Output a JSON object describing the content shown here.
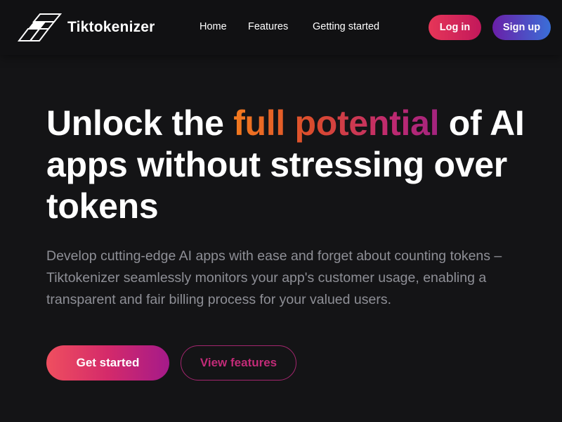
{
  "header": {
    "brand": "Tiktokenizer",
    "logo_icon": "tiktokenizer-logo-icon",
    "nav": [
      {
        "label": "Home"
      },
      {
        "label": "Features"
      },
      {
        "label": "Getting started"
      }
    ],
    "login_label": "Log in",
    "signup_label": "Sign up"
  },
  "hero": {
    "headline_before": "Unlock the ",
    "headline_highlight": "full potential",
    "headline_after": " of AI apps without stressing over tokens",
    "subtitle": "Develop cutting-edge AI apps with ease and forget about counting tokens – Tiktokenizer seamlessly monitors your app's customer usage, enabling a transparent and fair billing process for your valued users.",
    "cta_primary": "Get started",
    "cta_secondary": "View features"
  },
  "colors": {
    "background": "#141416",
    "header_background": "#111113",
    "login_gradient": [
      "#e63658",
      "#c2185b"
    ],
    "signup_gradient": [
      "#6a1fa8",
      "#3a6fd8"
    ],
    "highlight_gradient": [
      "#f27a1f",
      "#d9492f",
      "#c02a6f",
      "#a3247f"
    ],
    "subtitle_text": "#8e8f96",
    "secondary_cta_text": "#c22b78"
  }
}
